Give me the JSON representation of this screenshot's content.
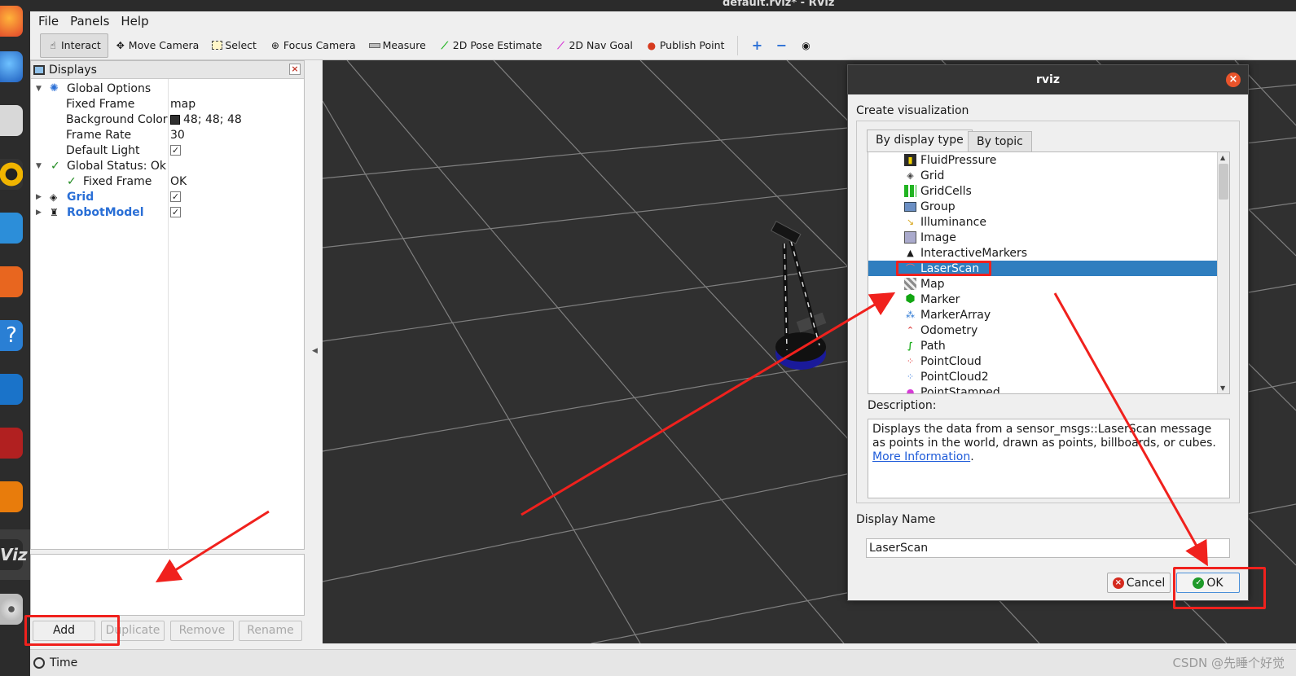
{
  "window": {
    "title": "default.rviz* - RViz"
  },
  "menu": [
    "File",
    "Panels",
    "Help"
  ],
  "toolbar": {
    "tools": [
      {
        "label": "Interact",
        "icon": "hand-icon"
      },
      {
        "label": "Move Camera",
        "icon": "move-camera-icon"
      },
      {
        "label": "Select",
        "icon": "select-icon"
      },
      {
        "label": "Focus Camera",
        "icon": "focus-camera-icon"
      },
      {
        "label": "Measure",
        "icon": "ruler-icon"
      },
      {
        "label": "2D Pose Estimate",
        "icon": "green-arrow-icon"
      },
      {
        "label": "2D Nav Goal",
        "icon": "pink-arrow-icon"
      },
      {
        "label": "Publish Point",
        "icon": "map-pin-icon"
      }
    ]
  },
  "displays": {
    "title": "Displays",
    "rows": [
      {
        "name": "Global Options",
        "value": ""
      },
      {
        "name": "Fixed Frame",
        "value": "map"
      },
      {
        "name": "Background Color",
        "value": "48; 48; 48"
      },
      {
        "name": "Frame Rate",
        "value": "30"
      },
      {
        "name": "Default Light",
        "value": "✓"
      },
      {
        "name": "Global Status: Ok",
        "value": ""
      },
      {
        "name": "Fixed Frame",
        "value": "OK"
      },
      {
        "name": "Grid",
        "value": "✓"
      },
      {
        "name": "RobotModel",
        "value": "✓"
      }
    ],
    "buttons": {
      "add": "Add",
      "duplicate": "Duplicate",
      "remove": "Remove",
      "rename": "Rename"
    }
  },
  "time_panel": {
    "label": "Time"
  },
  "dialog": {
    "title": "rviz",
    "section": "Create visualization",
    "tabs": [
      "By display type",
      "By topic"
    ],
    "items": [
      {
        "label": "FluidPressure",
        "icon": "fluid-pressure-icon",
        "color": "#2b2b2b"
      },
      {
        "label": "Grid",
        "icon": "grid-icon",
        "color": "#444444"
      },
      {
        "label": "GridCells",
        "icon": "grid-cells-icon",
        "color": "#22b422"
      },
      {
        "label": "Group",
        "icon": "folder-icon",
        "color": "#6b8fc4"
      },
      {
        "label": "Illuminance",
        "icon": "illuminance-icon",
        "color": "#d8a51a"
      },
      {
        "label": "Image",
        "icon": "image-icon",
        "color": "#555555"
      },
      {
        "label": "InteractiveMarkers",
        "icon": "interactive-markers-icon",
        "color": "#3a3a3a"
      },
      {
        "label": "LaserScan",
        "icon": "laser-scan-icon",
        "color": "#e53030"
      },
      {
        "label": "Map",
        "icon": "map-icon",
        "color": "#8a8a8a"
      },
      {
        "label": "Marker",
        "icon": "marker-icon",
        "color": "#12a612"
      },
      {
        "label": "MarkerArray",
        "icon": "marker-array-icon",
        "color": "#1f6fd1"
      },
      {
        "label": "Odometry",
        "icon": "odometry-icon",
        "color": "#d62020"
      },
      {
        "label": "Path",
        "icon": "path-icon",
        "color": "#1fae1f"
      },
      {
        "label": "PointCloud",
        "icon": "point-cloud-icon",
        "color": "#e03030"
      },
      {
        "label": "PointCloud2",
        "icon": "point-cloud2-icon",
        "color": "#3a7ee0"
      },
      {
        "label": "PointStamped",
        "icon": "point-stamped-icon",
        "color": "#d63ad6"
      }
    ],
    "selected_item": "LaserScan",
    "description_label": "Description:",
    "description_text": "Displays the data from a sensor_msgs::LaserScan message as points in the world, drawn as points, billboards, or cubes. ",
    "description_link": "More Information",
    "description_end": ".",
    "display_name_label": "Display Name",
    "display_name_value": "LaserScan",
    "cancel": "Cancel",
    "ok": "OK"
  },
  "watermark": "CSDN @先睡个好觉",
  "colors": {
    "viewport_bg": "#303030",
    "selection": "#2f7ebf",
    "annotation": "#f0211d"
  }
}
